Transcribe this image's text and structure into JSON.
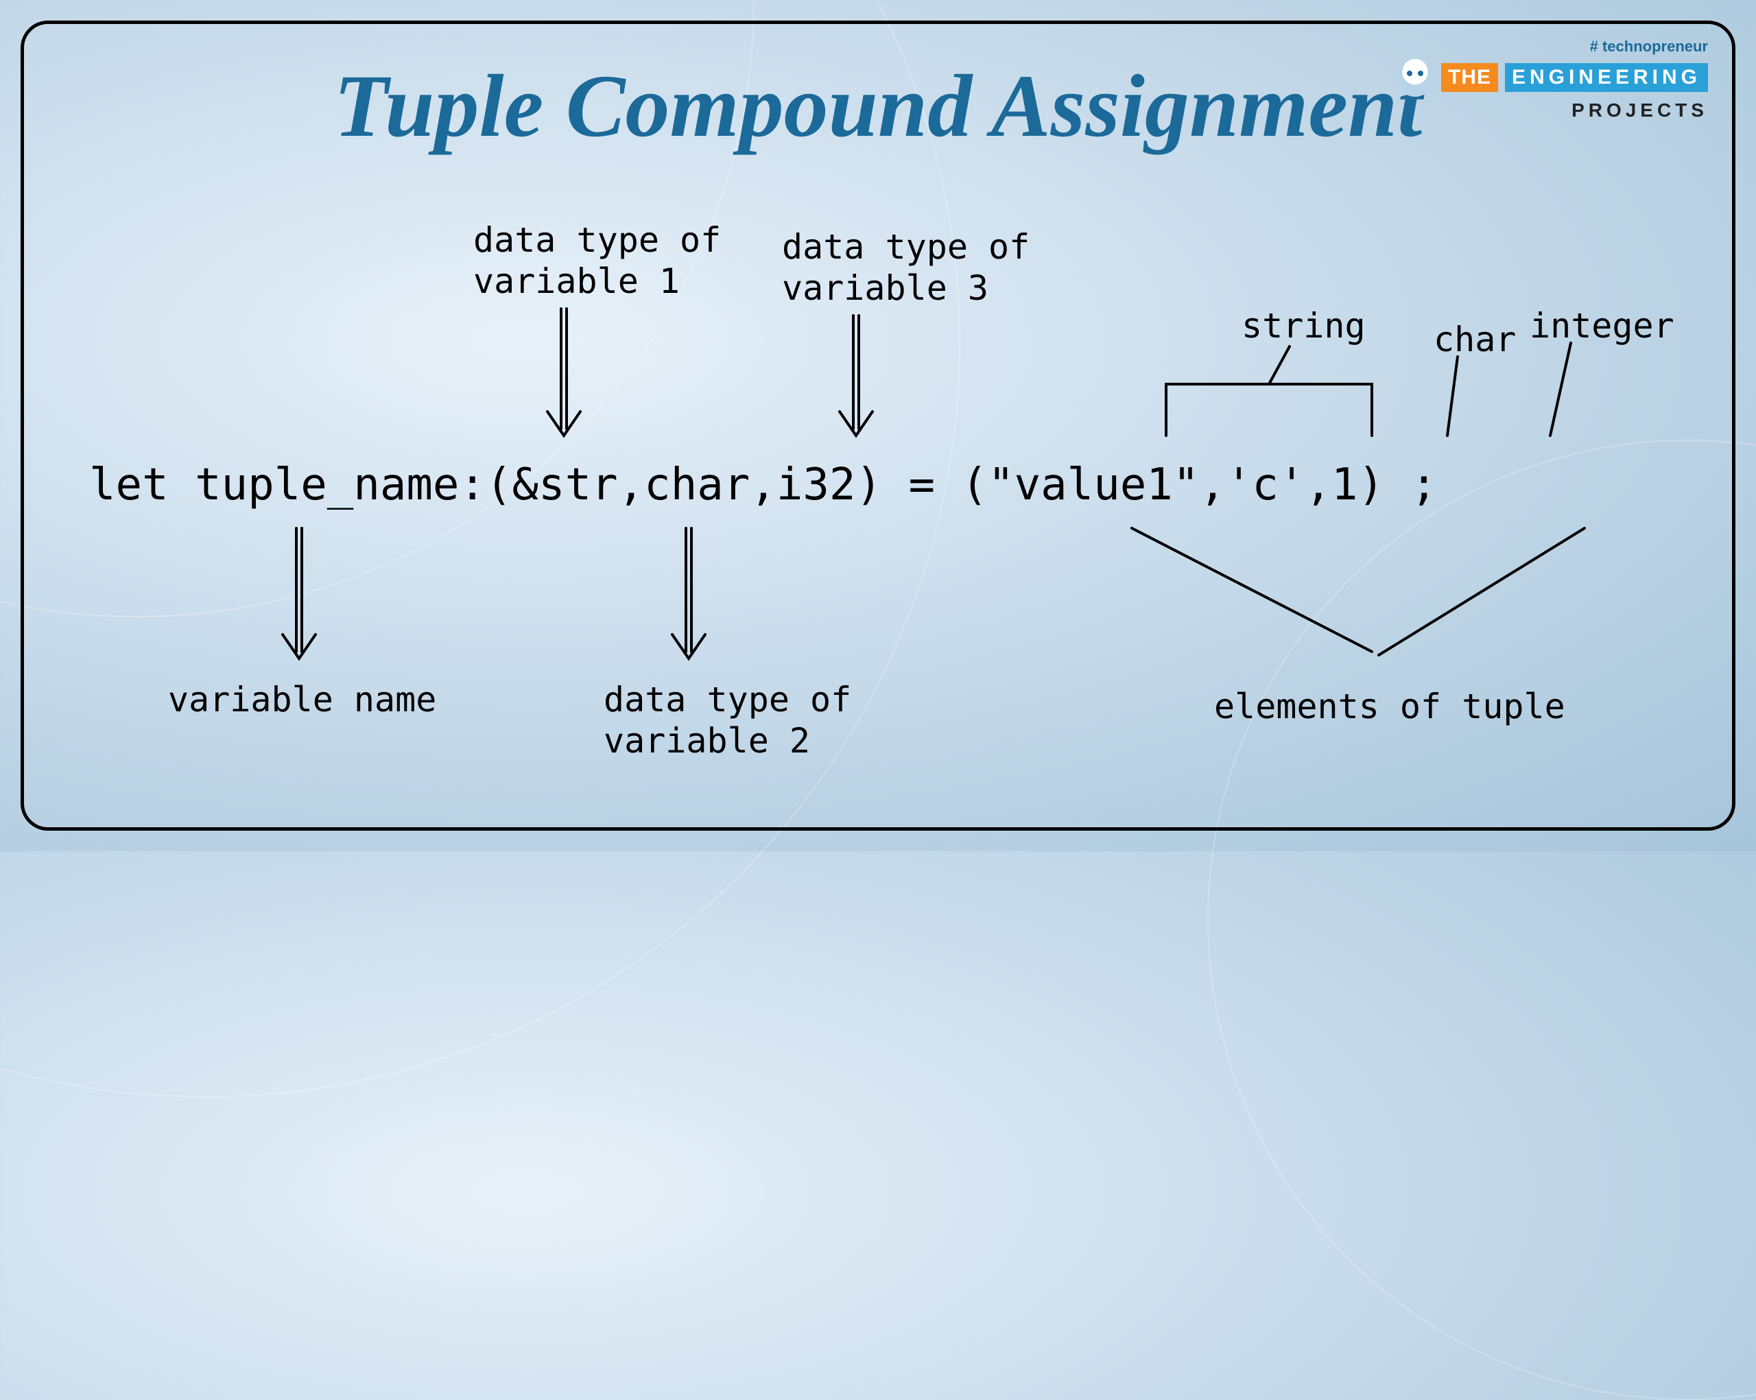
{
  "title": "Tuple Compound Assignment",
  "logo": {
    "hashtag": "# technopreneur",
    "the": "THE",
    "engineering": "ENGINEERING",
    "projects": "PROJECTS"
  },
  "code": "let tuple_name:(&str,char,i32) = (\"value1\",'c',1) ;",
  "annotations": {
    "datatype_var1_line1": "data type of",
    "datatype_var1_line2": "variable 1",
    "datatype_var3_line1": "data type of",
    "datatype_var3_line2": "variable 3",
    "string_label": "string",
    "char_label": "char",
    "integer_label": "integer",
    "variable_name": "variable name",
    "datatype_var2_line1": "data type of",
    "datatype_var2_line2": "variable 2",
    "elements_of_tuple": "elements of tuple"
  }
}
